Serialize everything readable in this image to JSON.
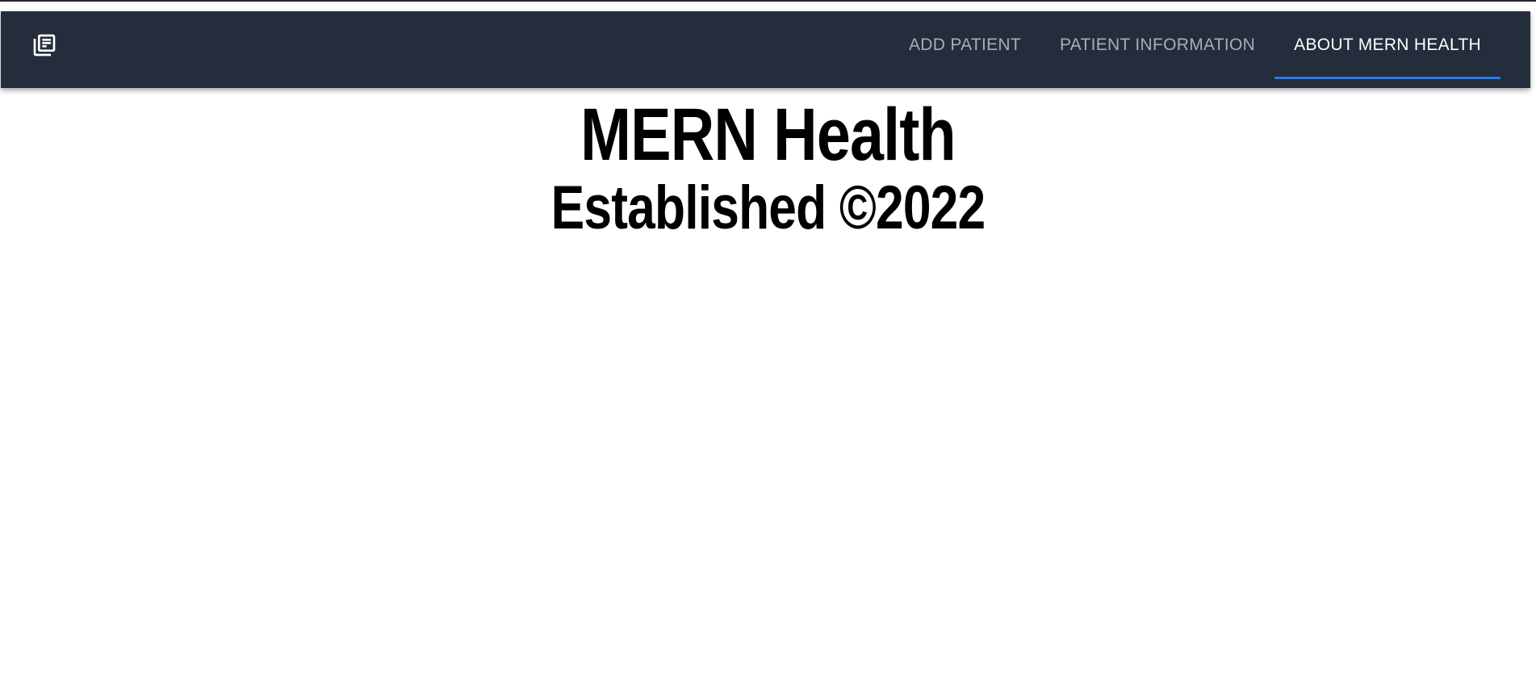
{
  "nav": {
    "logo_icon": "library-books-icon",
    "tabs": [
      {
        "label": "ADD PATIENT",
        "active": false
      },
      {
        "label": "PATIENT INFORMATION",
        "active": false
      },
      {
        "label": "ABOUT MERN HEALTH",
        "active": true
      }
    ],
    "colors": {
      "bar_background": "#232d3b",
      "active_indicator": "#2f7ae5",
      "active_text": "#ffffff",
      "inactive_text": "#a7aeb8"
    }
  },
  "main": {
    "title": "MERN Health",
    "subtitle": "Established ©2022"
  }
}
